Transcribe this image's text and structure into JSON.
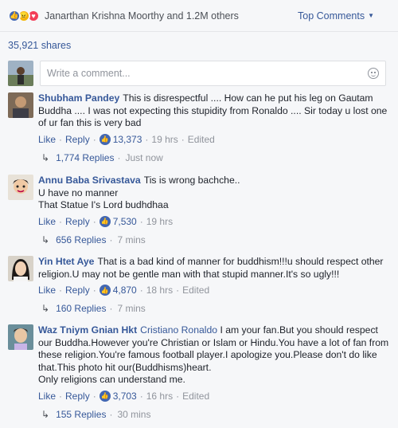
{
  "header": {
    "reaction_icons": [
      "like-icon",
      "angry-icon",
      "love-icon"
    ],
    "reactors_text": "Janarthan Krishna Moorthy and 1.2M others",
    "sort_label": "Top Comments"
  },
  "shares": "35,921 shares",
  "composer": {
    "placeholder": "Write a comment..."
  },
  "comments": [
    {
      "name": "Shubham Pandey",
      "text": "This is disrespectful .... How can he put his leg on Gautam Buddha .... I was not expecting this stupidity from Ronaldo .... Sir today u lost one of ur fan this is very bad",
      "like": "Like",
      "reply": "Reply",
      "likes": "13,373",
      "time": "19 hrs",
      "edited": "Edited",
      "replies": "1,774 Replies",
      "replies_time": "Just now"
    },
    {
      "name": "Annu Baba Srivastava",
      "line1": "Tis is wrong bachche..",
      "line2": "U have no manner",
      "line3": "That Statue I's Lord budhdhaa",
      "like": "Like",
      "reply": "Reply",
      "likes": "7,530",
      "time": "19 hrs",
      "replies": "656 Replies",
      "replies_time": "7 mins"
    },
    {
      "name": "Yin Htet Aye",
      "text": "That is a bad kind of manner for buddhism!!!u should respect other religion.U may not be gentle man with that stupid manner.It's so ugly!!!",
      "like": "Like",
      "reply": "Reply",
      "likes": "4,870",
      "time": "18 hrs",
      "edited": "Edited",
      "replies": "160 Replies",
      "replies_time": "7 mins"
    },
    {
      "name": "Waz Tniym Gnian Hkt",
      "mention": "Cristiano Ronaldo",
      "text": "I am your fan.But you should respect our Buddha.However you're Christian or Islam or Hindu.You have a lot of fan from these religion.You're famous football player.I apologize you.Please don't do like that.This photo hit our(Buddhisms)heart.",
      "line2": "Only religions can understand me.",
      "like": "Like",
      "reply": "Reply",
      "likes": "3,703",
      "time": "16 hrs",
      "edited": "Edited",
      "replies": "155 Replies",
      "replies_time": "30 mins"
    }
  ]
}
